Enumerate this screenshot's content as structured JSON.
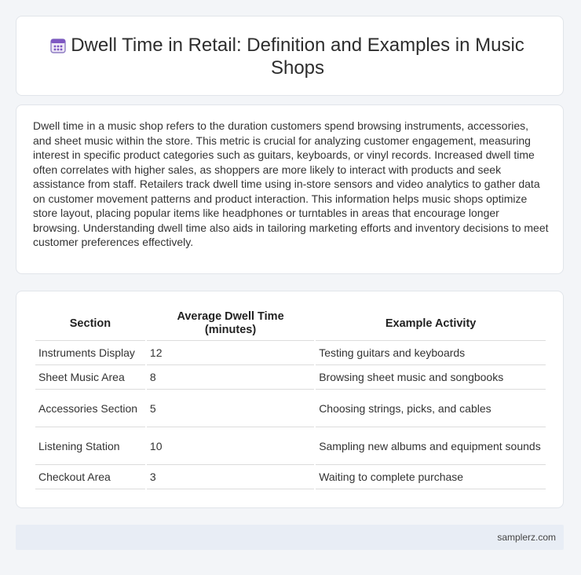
{
  "header": {
    "icon": "calendar-icon",
    "title": "Dwell Time in Retail: Definition and Examples in Music Shops"
  },
  "intro": {
    "text": "Dwell time in a music shop refers to the duration customers spend browsing instruments, accessories, and sheet music within the store. This metric is crucial for analyzing customer engagement, measuring interest in specific product categories such as guitars, keyboards, or vinyl records. Increased dwell time often correlates with higher sales, as shoppers are more likely to interact with products and seek assistance from staff. Retailers track dwell time using in-store sensors and video analytics to gather data on customer movement patterns and product interaction. This information helps music shops optimize store layout, placing popular items like headphones or turntables in areas that encourage longer browsing. Understanding dwell time also aids in tailoring marketing efforts and inventory decisions to meet customer preferences effectively."
  },
  "table": {
    "headers": [
      "Section",
      "Average Dwell Time (minutes)",
      "Example Activity"
    ],
    "rows": [
      [
        "Instruments Display",
        "12",
        "Testing guitars and keyboards"
      ],
      [
        "Sheet Music Area",
        "8",
        "Browsing sheet music and songbooks"
      ],
      [
        "Accessories Section",
        "5",
        "Choosing strings, picks, and cables"
      ],
      [
        "Listening Station",
        "10",
        "Sampling new albums and equipment sounds"
      ],
      [
        "Checkout Area",
        "3",
        "Waiting to complete purchase"
      ]
    ]
  },
  "footer": {
    "site": "samplerz.com"
  },
  "colors": {
    "page_bg": "#f3f5f8",
    "card_bg": "#ffffff",
    "footer_bg": "#e8edf5",
    "icon_purple": "#8e7cc3"
  }
}
